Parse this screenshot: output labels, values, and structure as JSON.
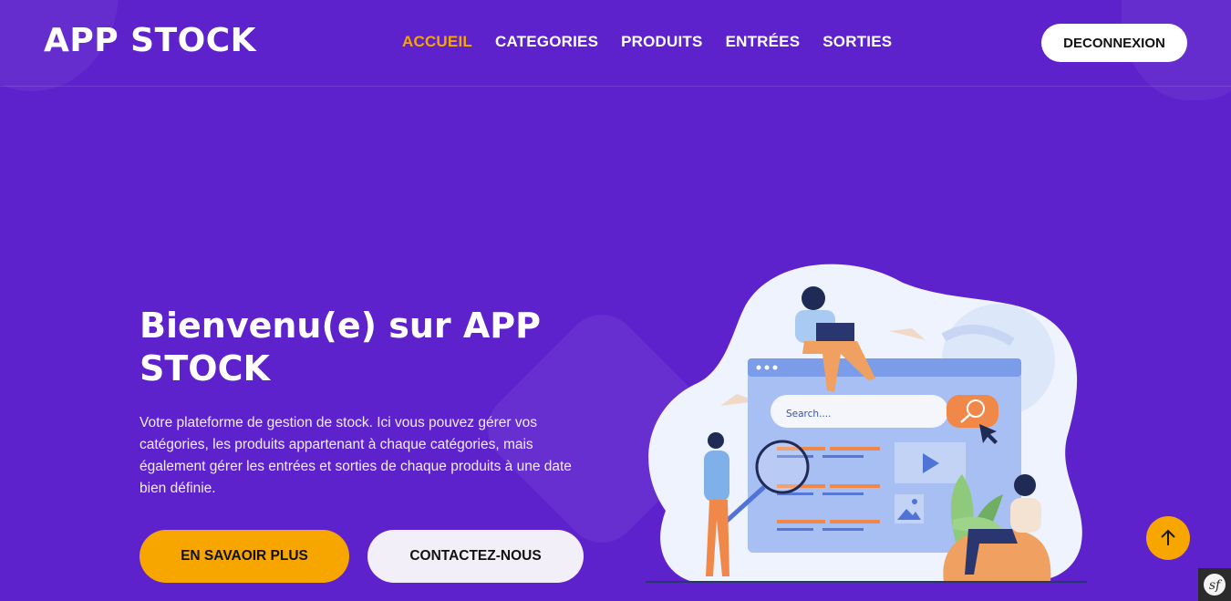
{
  "header": {
    "logo": "APP STOCK",
    "nav": [
      {
        "label": "ACCUEIL",
        "active": true
      },
      {
        "label": "CATEGORIES",
        "active": false
      },
      {
        "label": "PRODUITS",
        "active": false
      },
      {
        "label": "ENTRÉES",
        "active": false
      },
      {
        "label": "SORTIES",
        "active": false
      }
    ],
    "logout_label": "DECONNEXION"
  },
  "hero": {
    "title": "Bienvenu(e) sur APP STOCK",
    "text": "Votre plateforme de gestion de stock. Ici vous pouvez gérer vos catégories, les produits appartenant à chaque catégories, mais également gérer les entrées et sorties de chaque produits à une date bien définie.",
    "btn_more": "EN SAVAOIR PLUS",
    "btn_contact": "CONTACTEZ-NOUS"
  },
  "illustration": {
    "search_placeholder": "Search...."
  },
  "icons": {
    "scroll_top": "arrow-up-icon",
    "debug": "symfony-icon"
  },
  "colors": {
    "background": "#5e22cc",
    "accent": "#f7a600",
    "button_light": "#f3eff8"
  }
}
